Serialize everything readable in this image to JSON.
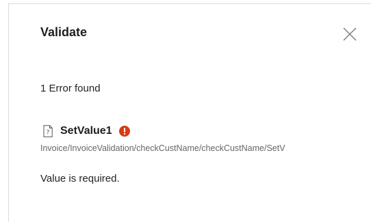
{
  "dialog": {
    "title": "Validate",
    "close_icon": "close-icon"
  },
  "summary": "1 Error found",
  "errors": [
    {
      "icon": "document-question-icon",
      "name": "SetValue1",
      "status_icon": "error-icon",
      "status_color": "#d93a14",
      "path": "Invoice/InvoiceValidation/checkCustName/checkCustName/SetV",
      "message": "Value is required."
    }
  ]
}
